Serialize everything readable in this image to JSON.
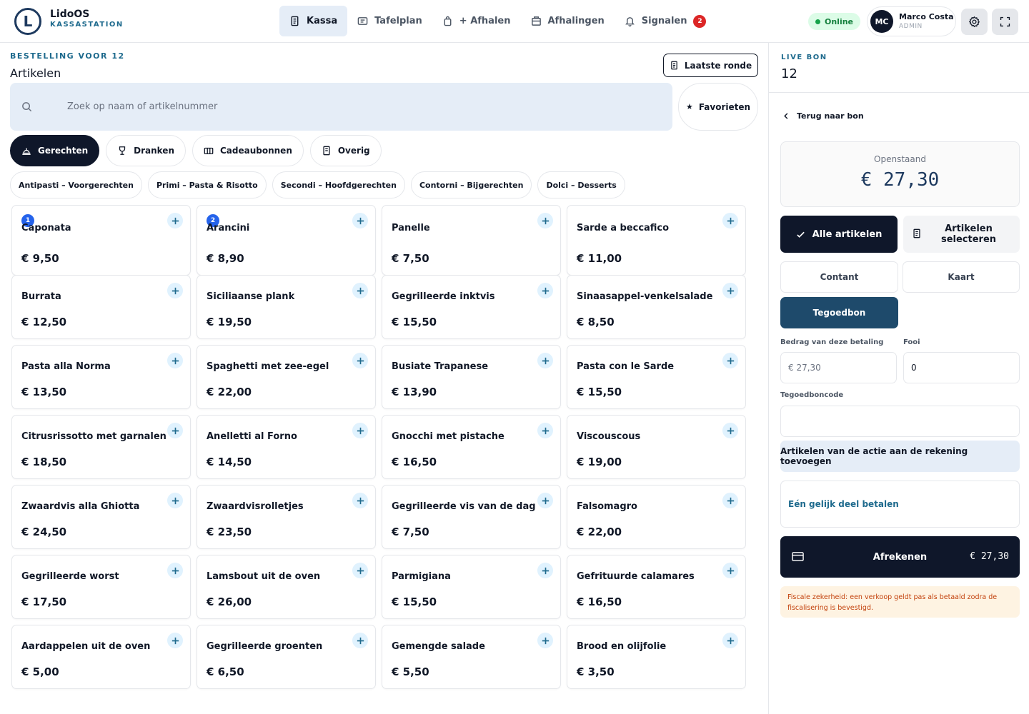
{
  "brand": {
    "logo_letter": "L",
    "name": "LidoOS",
    "subtitle": "KASSASTATION"
  },
  "nav": [
    {
      "label": "Kassa",
      "icon": "receipt-icon",
      "active": true
    },
    {
      "label": "Tafelplan",
      "icon": "table-plan-icon"
    },
    {
      "label": "+ Afhalen",
      "icon": "bag-icon"
    },
    {
      "label": "Afhalingen",
      "icon": "box-icon"
    },
    {
      "label": "Signalen",
      "icon": "bell-icon",
      "badge": "2"
    }
  ],
  "status": {
    "label": "Online",
    "color": "#16a34a"
  },
  "user": {
    "initials": "MC",
    "name": "Marco Costa",
    "role": "ADMIN"
  },
  "header_icons": [
    "settings-icon",
    "fullscreen-icon"
  ],
  "order": {
    "label": "BESTELLING VOOR 12",
    "title": "Artikelen",
    "last_round_label": "Laatste ronde"
  },
  "search": {
    "placeholder": "Zoek op naam of artikelnummer",
    "favorites_label": "Favorieten"
  },
  "categories": [
    {
      "label": "Gerechten",
      "icon": "dish-icon",
      "active": true
    },
    {
      "label": "Dranken",
      "icon": "glass-icon"
    },
    {
      "label": "Cadeaubonnen",
      "icon": "gift-card-icon"
    },
    {
      "label": "Overig",
      "icon": "document-icon"
    }
  ],
  "subcategories": [
    "Antipasti – Voorgerechten",
    "Primi – Pasta & Risotto",
    "Secondi – Hoofdgerechten",
    "Contorni – Bijgerechten",
    "Dolci – Desserts"
  ],
  "items": [
    {
      "name": "Caponata",
      "price": "€ 9,50",
      "count": "1"
    },
    {
      "name": "Arancini",
      "price": "€ 8,90",
      "count": "2"
    },
    {
      "name": "Panelle",
      "price": "€ 7,50"
    },
    {
      "name": "Sarde a beccafico",
      "price": "€ 11,00"
    },
    {
      "name": "Burrata",
      "price": "€ 12,50"
    },
    {
      "name": "Siciliaanse plank",
      "price": "€ 19,50"
    },
    {
      "name": "Gegrilleerde inktvis",
      "price": "€ 15,50"
    },
    {
      "name": "Sinaasappel-venkelsalade",
      "price": "€ 8,50"
    },
    {
      "name": "Pasta alla Norma",
      "price": "€ 13,50"
    },
    {
      "name": "Spaghetti met zee-egel",
      "price": "€ 22,00"
    },
    {
      "name": "Busiate Trapanese",
      "price": "€ 13,90"
    },
    {
      "name": "Pasta con le Sarde",
      "price": "€ 15,50"
    },
    {
      "name": "Citrusrissotto met garnalen",
      "price": "€ 18,50"
    },
    {
      "name": "Anelletti al Forno",
      "price": "€ 14,50"
    },
    {
      "name": "Gnocchi met pistache",
      "price": "€ 16,50"
    },
    {
      "name": "Viscouscous",
      "price": "€ 19,00"
    },
    {
      "name": "Zwaardvis alla Ghiotta",
      "price": "€ 24,50"
    },
    {
      "name": "Zwaardvisrolletjes",
      "price": "€ 23,50"
    },
    {
      "name": "Gegrilleerde vis van de dag",
      "price": "€ 7,50"
    },
    {
      "name": "Falsomagro",
      "price": "€ 22,00"
    },
    {
      "name": "Gegrilleerde worst",
      "price": "€ 17,50"
    },
    {
      "name": "Lamsbout uit de oven",
      "price": "€ 26,00"
    },
    {
      "name": "Parmigiana",
      "price": "€ 15,50"
    },
    {
      "name": "Gefrituurde calamares",
      "price": "€ 16,50"
    },
    {
      "name": "Aardappelen uit de oven",
      "price": "€ 5,00"
    },
    {
      "name": "Gegrilleerde groenten",
      "price": "€ 6,50"
    },
    {
      "name": "Gemengde salade",
      "price": "€ 5,50"
    },
    {
      "name": "Brood en olijfolie",
      "price": "€ 3,50"
    }
  ],
  "bill": {
    "label": "LIVE BON",
    "number": "12",
    "back_label": "Terug naar bon",
    "open_label": "Openstaand",
    "open_amount": "€ 27,30",
    "all_items_label": "Alle artikelen",
    "select_items_label": "Artikelen selecteren",
    "methods": [
      "Contant",
      "Kaart",
      "Tegoedbon"
    ],
    "active_method": "Tegoedbon",
    "amount_label": "Bedrag van deze betaling",
    "amount_placeholder": "€ 27,30",
    "tip_label": "Fooi",
    "tip_value": "0",
    "voucher_code_label": "Tegoedboncode",
    "voucher_code_value": "",
    "add_action_label": "Artikelen van de actie aan de rekening toevoegen",
    "split_label": "Eén gelijk deel betalen",
    "checkout_label": "Afrekenen",
    "checkout_amount": "€ 27,30",
    "notice": "Fiscale zekerheid: een verkoop geldt pas als betaald zodra de fiscalisering is bevestigd."
  },
  "colors": {
    "accent": "#1e6a8d",
    "dark": "#0f172a",
    "badge": "#dc2626",
    "count_badge": "#2563eb",
    "notice_bg": "#fef3e2",
    "notice_text": "#c2410c"
  }
}
